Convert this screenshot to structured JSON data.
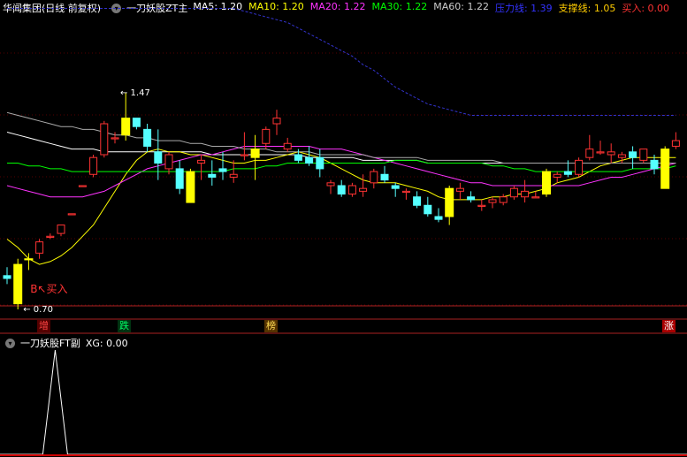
{
  "main_header": {
    "title": "华闻集团(日线 前复权)",
    "indicator_name": "一刀妖股ZT主",
    "indicators": [
      {
        "label": "MA5: 1.20",
        "color": "#ffffff"
      },
      {
        "label": "MA10: 1.20",
        "color": "#ffff00"
      },
      {
        "label": "MA20: 1.22",
        "color": "#ff33ff"
      },
      {
        "label": "MA30: 1.22",
        "color": "#00ff00"
      },
      {
        "label": "MA60: 1.22",
        "color": "#cccccc"
      },
      {
        "label": "压力线: 1.39",
        "color": "#3333ff"
      },
      {
        "label": "支撑线: 1.05",
        "color": "#ffcc00"
      },
      {
        "label": "买入: 0.00",
        "color": "#ff3333"
      }
    ]
  },
  "price_annotations": {
    "high": "1.47",
    "low": "0.70",
    "buy_signal": "B↖买入"
  },
  "signal_tags": [
    {
      "label": "增",
      "color": "#ff4444",
      "bg": "#550000"
    },
    {
      "label": "跌",
      "color": "#00ff66",
      "bg": "#003311"
    },
    {
      "label": "榜",
      "color": "#ffdd55",
      "bg": "#553300"
    },
    {
      "label": "涨",
      "color": "#ffffff",
      "bg": "#aa0000"
    }
  ],
  "sub_header": {
    "indicator_name": "一刀妖股FT副",
    "value_label": "XG: 0.00"
  },
  "colors": {
    "up": "#ff3333",
    "down": "#55ffff",
    "zt": "#ffff00",
    "resistance": "#3333cc",
    "grid": "#550000"
  },
  "chart_data": {
    "type": "candlestick",
    "price_range": [
      0.7,
      1.47
    ],
    "candles": [
      {
        "o": 0.82,
        "h": 0.85,
        "l": 0.79,
        "c": 0.81
      },
      {
        "o": 0.72,
        "h": 0.88,
        "l": 0.7,
        "c": 0.86,
        "zt": true
      },
      {
        "o": 0.88,
        "h": 0.9,
        "l": 0.84,
        "c": 0.88,
        "zt": true
      },
      {
        "o": 0.9,
        "h": 0.95,
        "l": 0.88,
        "c": 0.94
      },
      {
        "o": 0.96,
        "h": 0.97,
        "l": 0.95,
        "c": 0.96
      },
      {
        "o": 0.97,
        "h": 1.0,
        "l": 0.96,
        "c": 1.0
      },
      {
        "o": 1.04,
        "h": 1.04,
        "l": 1.04,
        "c": 1.04
      },
      {
        "o": 1.14,
        "h": 1.14,
        "l": 1.14,
        "c": 1.14
      },
      {
        "o": 1.18,
        "h": 1.25,
        "l": 1.17,
        "c": 1.24
      },
      {
        "o": 1.25,
        "h": 1.37,
        "l": 1.24,
        "c": 1.36
      },
      {
        "o": 1.31,
        "h": 1.33,
        "l": 1.29,
        "c": 1.31
      },
      {
        "o": 1.38,
        "h": 1.47,
        "l": 1.3,
        "c": 1.32,
        "zt": true
      },
      {
        "o": 1.38,
        "h": 1.38,
        "l": 1.34,
        "c": 1.35
      },
      {
        "o": 1.34,
        "h": 1.36,
        "l": 1.26,
        "c": 1.28
      },
      {
        "o": 1.26,
        "h": 1.34,
        "l": 1.16,
        "c": 1.22
      },
      {
        "o": 1.2,
        "h": 1.26,
        "l": 1.18,
        "c": 1.25
      },
      {
        "o": 1.2,
        "h": 1.23,
        "l": 1.11,
        "c": 1.13
      },
      {
        "o": 1.08,
        "h": 1.2,
        "l": 1.08,
        "c": 1.19,
        "zt": true
      },
      {
        "o": 1.22,
        "h": 1.25,
        "l": 1.16,
        "c": 1.23
      },
      {
        "o": 1.18,
        "h": 1.23,
        "l": 1.14,
        "c": 1.17
      },
      {
        "o": 1.2,
        "h": 1.26,
        "l": 1.16,
        "c": 1.19
      },
      {
        "o": 1.17,
        "h": 1.23,
        "l": 1.15,
        "c": 1.18
      },
      {
        "o": 1.25,
        "h": 1.33,
        "l": 1.23,
        "c": 1.25
      },
      {
        "o": 1.24,
        "h": 1.32,
        "l": 1.16,
        "c": 1.27,
        "zt": true
      },
      {
        "o": 1.29,
        "h": 1.35,
        "l": 1.27,
        "c": 1.34
      },
      {
        "o": 1.36,
        "h": 1.41,
        "l": 1.32,
        "c": 1.38
      },
      {
        "o": 1.27,
        "h": 1.31,
        "l": 1.26,
        "c": 1.29
      },
      {
        "o": 1.25,
        "h": 1.27,
        "l": 1.22,
        "c": 1.23
      },
      {
        "o": 1.24,
        "h": 1.28,
        "l": 1.21,
        "c": 1.22
      },
      {
        "o": 1.24,
        "h": 1.27,
        "l": 1.17,
        "c": 1.2
      },
      {
        "o": 1.14,
        "h": 1.16,
        "l": 1.11,
        "c": 1.15
      },
      {
        "o": 1.14,
        "h": 1.16,
        "l": 1.1,
        "c": 1.11
      },
      {
        "o": 1.11,
        "h": 1.15,
        "l": 1.1,
        "c": 1.14
      },
      {
        "o": 1.12,
        "h": 1.18,
        "l": 1.1,
        "c": 1.13
      },
      {
        "o": 1.15,
        "h": 1.2,
        "l": 1.13,
        "c": 1.19
      },
      {
        "o": 1.18,
        "h": 1.21,
        "l": 1.15,
        "c": 1.16
      },
      {
        "o": 1.14,
        "h": 1.15,
        "l": 1.1,
        "c": 1.13
      },
      {
        "o": 1.12,
        "h": 1.13,
        "l": 1.09,
        "c": 1.12
      },
      {
        "o": 1.1,
        "h": 1.12,
        "l": 1.06,
        "c": 1.07
      },
      {
        "o": 1.07,
        "h": 1.1,
        "l": 1.03,
        "c": 1.04
      },
      {
        "o": 1.03,
        "h": 1.06,
        "l": 1.01,
        "c": 1.02
      },
      {
        "o": 1.03,
        "h": 1.14,
        "l": 1.0,
        "c": 1.13,
        "zt": true
      },
      {
        "o": 1.12,
        "h": 1.15,
        "l": 1.09,
        "c": 1.13
      },
      {
        "o": 1.1,
        "h": 1.12,
        "l": 1.08,
        "c": 1.09
      },
      {
        "o": 1.07,
        "h": 1.09,
        "l": 1.05,
        "c": 1.07
      },
      {
        "o": 1.08,
        "h": 1.1,
        "l": 1.06,
        "c": 1.09
      },
      {
        "o": 1.08,
        "h": 1.11,
        "l": 1.07,
        "c": 1.1
      },
      {
        "o": 1.1,
        "h": 1.14,
        "l": 1.09,
        "c": 1.13
      },
      {
        "o": 1.1,
        "h": 1.16,
        "l": 1.08,
        "c": 1.12
      },
      {
        "o": 1.1,
        "h": 1.12,
        "l": 1.1,
        "c": 1.1
      },
      {
        "o": 1.11,
        "h": 1.2,
        "l": 1.1,
        "c": 1.19,
        "zt": true
      },
      {
        "o": 1.17,
        "h": 1.19,
        "l": 1.15,
        "c": 1.18
      },
      {
        "o": 1.19,
        "h": 1.23,
        "l": 1.17,
        "c": 1.18
      },
      {
        "o": 1.18,
        "h": 1.24,
        "l": 1.17,
        "c": 1.23
      },
      {
        "o": 1.24,
        "h": 1.32,
        "l": 1.23,
        "c": 1.27
      },
      {
        "o": 1.26,
        "h": 1.3,
        "l": 1.25,
        "c": 1.26
      },
      {
        "o": 1.25,
        "h": 1.29,
        "l": 1.22,
        "c": 1.26
      },
      {
        "o": 1.24,
        "h": 1.26,
        "l": 1.22,
        "c": 1.25
      },
      {
        "o": 1.26,
        "h": 1.28,
        "l": 1.2,
        "c": 1.24
      },
      {
        "o": 1.23,
        "h": 1.27,
        "l": 1.22,
        "c": 1.27
      },
      {
        "o": 1.23,
        "h": 1.25,
        "l": 1.18,
        "c": 1.2
      },
      {
        "o": 1.13,
        "h": 1.28,
        "l": 1.13,
        "c": 1.27,
        "zt": true
      },
      {
        "o": 1.28,
        "h": 1.33,
        "l": 1.27,
        "c": 1.3
      }
    ],
    "ma_series": [
      {
        "name": "MA5",
        "color": "#ffffff",
        "values": [
          1.33,
          1.32,
          1.31,
          1.3,
          1.29,
          1.28,
          1.27,
          1.27,
          1.27,
          1.26,
          1.26,
          1.26,
          1.26,
          1.26,
          1.26,
          1.26,
          1.26,
          1.26,
          1.26,
          1.25,
          1.25,
          1.25,
          1.25,
          1.25,
          1.25,
          1.25,
          1.25,
          1.25,
          1.24,
          1.24,
          1.24,
          1.24,
          1.24,
          1.23,
          1.23,
          1.23,
          1.23,
          1.23,
          1.23,
          1.22,
          1.22,
          1.22,
          1.22,
          1.22,
          1.22,
          1.22,
          1.22,
          1.22,
          1.22,
          1.22,
          1.22,
          1.22,
          1.22,
          1.22,
          1.22,
          1.22,
          1.22,
          1.22,
          1.22,
          1.22,
          1.22,
          1.22,
          1.22
        ]
      },
      {
        "name": "MA10",
        "color": "#ffff00",
        "values": [
          0.95,
          0.92,
          0.88,
          0.86,
          0.87,
          0.89,
          0.92,
          0.96,
          1.0,
          1.06,
          1.12,
          1.18,
          1.23,
          1.26,
          1.27,
          1.26,
          1.26,
          1.25,
          1.25,
          1.24,
          1.23,
          1.22,
          1.22,
          1.23,
          1.23,
          1.24,
          1.25,
          1.26,
          1.25,
          1.24,
          1.22,
          1.2,
          1.18,
          1.16,
          1.15,
          1.15,
          1.15,
          1.14,
          1.13,
          1.12,
          1.1,
          1.09,
          1.09,
          1.09,
          1.09,
          1.1,
          1.1,
          1.11,
          1.11,
          1.12,
          1.13,
          1.15,
          1.16,
          1.17,
          1.19,
          1.21,
          1.22,
          1.23,
          1.24,
          1.24,
          1.24,
          1.24,
          1.24
        ]
      },
      {
        "name": "MA20",
        "color": "#ff33ff",
        "values": [
          1.14,
          1.13,
          1.12,
          1.11,
          1.1,
          1.1,
          1.1,
          1.1,
          1.11,
          1.12,
          1.14,
          1.16,
          1.18,
          1.2,
          1.21,
          1.22,
          1.23,
          1.24,
          1.25,
          1.25,
          1.26,
          1.27,
          1.28,
          1.28,
          1.28,
          1.28,
          1.28,
          1.28,
          1.28,
          1.27,
          1.27,
          1.27,
          1.26,
          1.25,
          1.24,
          1.23,
          1.22,
          1.21,
          1.2,
          1.19,
          1.18,
          1.17,
          1.16,
          1.15,
          1.15,
          1.14,
          1.14,
          1.14,
          1.14,
          1.14,
          1.14,
          1.14,
          1.14,
          1.14,
          1.15,
          1.16,
          1.17,
          1.17,
          1.18,
          1.19,
          1.2,
          1.21,
          1.22
        ]
      },
      {
        "name": "MA30",
        "color": "#00ff00",
        "values": [
          1.22,
          1.22,
          1.21,
          1.21,
          1.2,
          1.2,
          1.19,
          1.19,
          1.19,
          1.19,
          1.19,
          1.19,
          1.19,
          1.19,
          1.19,
          1.19,
          1.19,
          1.19,
          1.19,
          1.19,
          1.19,
          1.2,
          1.2,
          1.2,
          1.21,
          1.21,
          1.22,
          1.22,
          1.22,
          1.22,
          1.22,
          1.22,
          1.22,
          1.22,
          1.22,
          1.22,
          1.23,
          1.23,
          1.23,
          1.22,
          1.22,
          1.22,
          1.22,
          1.22,
          1.22,
          1.21,
          1.21,
          1.2,
          1.2,
          1.19,
          1.19,
          1.19,
          1.19,
          1.19,
          1.19,
          1.19,
          1.19,
          1.19,
          1.2,
          1.2,
          1.2,
          1.2,
          1.21
        ]
      },
      {
        "name": "MA60",
        "color": "#aaaaaa",
        "values": [
          1.4,
          1.39,
          1.38,
          1.37,
          1.36,
          1.35,
          1.35,
          1.34,
          1.34,
          1.33,
          1.32,
          1.32,
          1.31,
          1.31,
          1.3,
          1.3,
          1.3,
          1.29,
          1.29,
          1.28,
          1.28,
          1.28,
          1.27,
          1.27,
          1.27,
          1.26,
          1.26,
          1.26,
          1.26,
          1.25,
          1.25,
          1.25,
          1.25,
          1.25,
          1.24,
          1.24,
          1.24,
          1.24,
          1.24,
          1.23,
          1.23,
          1.23,
          1.23,
          1.23,
          1.23,
          1.23,
          1.22,
          1.22,
          1.22,
          1.22,
          1.22,
          1.22,
          1.22,
          1.22,
          1.22,
          1.22,
          1.22,
          1.22,
          1.22,
          1.22,
          1.22,
          1.22,
          1.22
        ]
      },
      {
        "name": "压力线",
        "color": "#3333cc",
        "dashed": true,
        "values": [
          1.77,
          1.77,
          1.77,
          1.77,
          1.77,
          1.77,
          1.77,
          1.77,
          1.77,
          1.77,
          1.77,
          1.77,
          1.77,
          1.77,
          1.77,
          1.77,
          1.77,
          1.77,
          1.77,
          1.77,
          1.77,
          1.77,
          1.76,
          1.75,
          1.74,
          1.73,
          1.72,
          1.7,
          1.68,
          1.66,
          1.64,
          1.62,
          1.6,
          1.57,
          1.55,
          1.52,
          1.49,
          1.47,
          1.45,
          1.43,
          1.42,
          1.41,
          1.4,
          1.39,
          1.39,
          1.39,
          1.39,
          1.39,
          1.39,
          1.39,
          1.39,
          1.39,
          1.39,
          1.39,
          1.39,
          1.39,
          1.39,
          1.39,
          1.39,
          1.39,
          1.39,
          1.39,
          1.39
        ]
      }
    ],
    "sub_indicator": {
      "name": "XG",
      "values_pulse_index": 2,
      "value_range": [
        0,
        1
      ]
    }
  }
}
